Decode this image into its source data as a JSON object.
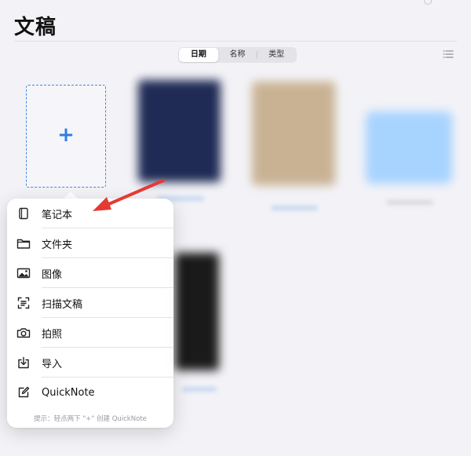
{
  "header": {
    "title": "文稿"
  },
  "sort_control": {
    "options": [
      "日期",
      "名称",
      "类型"
    ],
    "selected": "日期"
  },
  "new_document": {
    "plus_glyph": "+"
  },
  "create_menu": {
    "items": [
      {
        "label": "笔记本",
        "icon": "notebook-icon"
      },
      {
        "label": "文件夹",
        "icon": "folder-icon"
      },
      {
        "label": "图像",
        "icon": "image-icon"
      },
      {
        "label": "扫描文稿",
        "icon": "scan-icon"
      },
      {
        "label": "拍照",
        "icon": "camera-icon"
      },
      {
        "label": "导入",
        "icon": "import-icon"
      },
      {
        "label": "QuickNote",
        "icon": "quicknote-icon"
      }
    ],
    "hint": "提示：轻点两下 \"+\" 创建 QuickNote"
  },
  "colors": {
    "accent": "#2f7fe3",
    "annotation_arrow": "#e53935",
    "background": "#f3f3f7"
  }
}
